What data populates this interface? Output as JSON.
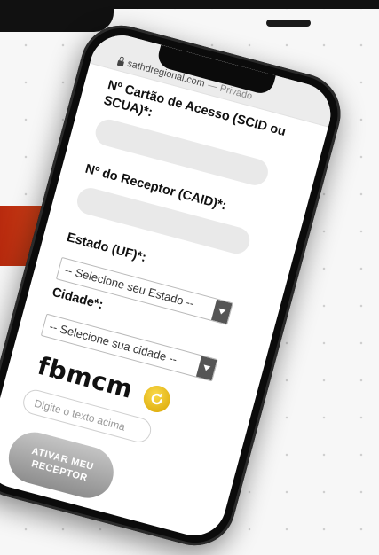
{
  "browser": {
    "url": "sathdregional.com",
    "mode": "— Privado"
  },
  "form": {
    "card_label": "Nº Cartão de Acesso (SCID ou SCUA)*:",
    "receiver_label": "Nº do Receptor (CAID)*:",
    "state_label": "Estado (UF)*:",
    "state_select": "-- Selecione seu Estado --",
    "city_label": "Cidade*:",
    "city_select": "-- Selecione sua cidade --",
    "captcha_text": "fbmcm",
    "captcha_placeholder": "Digite o texto acima",
    "submit_label": "ATIVAR MEU RECEPTOR"
  },
  "colors": {
    "accent_red": "#c8361a",
    "refresh_yellow": "#e8b400",
    "button_gray": "#a9a9a9"
  },
  "icons": {
    "lock": "lock-icon",
    "refresh": "refresh-icon",
    "dropdown": "chevron-down-icon"
  }
}
